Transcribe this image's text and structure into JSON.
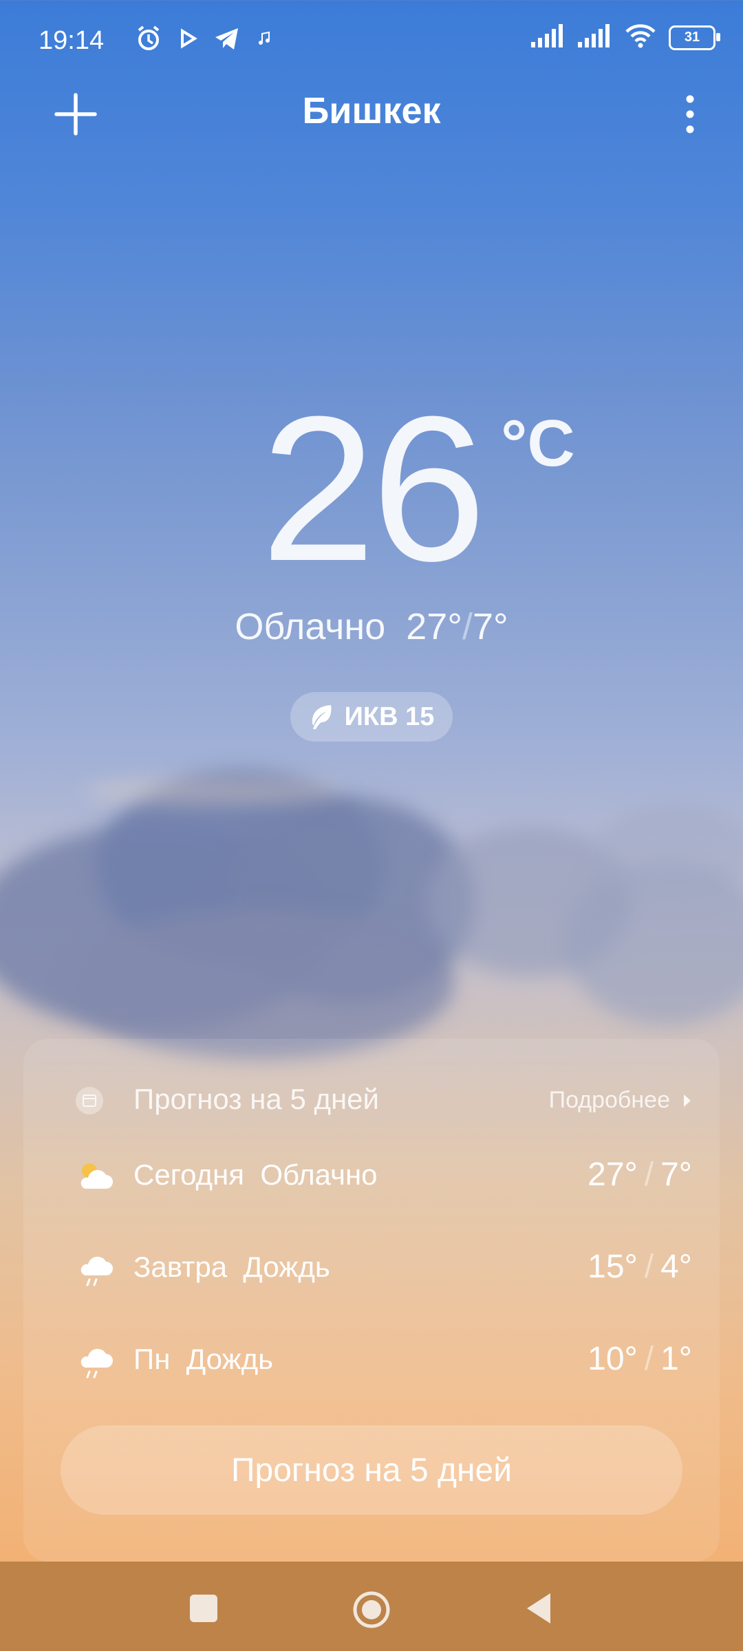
{
  "status_bar": {
    "time": "19:14",
    "battery": "31",
    "left_icons": [
      "alarm-icon",
      "play-icon",
      "telegram-icon",
      "music-icon"
    ],
    "right_icons": [
      "signal-icon",
      "signal-icon",
      "wifi-icon",
      "battery-icon"
    ]
  },
  "header": {
    "city": "Бишкек",
    "add_icon": "plus-icon",
    "menu_icon": "more-vert-icon"
  },
  "current": {
    "temperature": "26",
    "unit": "°C",
    "condition": "Облачно",
    "high": "27°",
    "low": "7°"
  },
  "aqi": {
    "label": "ИКВ 15",
    "icon": "leaf-icon"
  },
  "forecast_card": {
    "title": "Прогноз на 5 дней",
    "more_label": "Подробнее",
    "rows": [
      {
        "day": "Сегодня",
        "condition": "Облачно",
        "high": "27°",
        "low": "7°",
        "icon": "partly-cloudy-icon"
      },
      {
        "day": "Завтра",
        "condition": "Дождь",
        "high": "15°",
        "low": "4°",
        "icon": "rain-icon"
      },
      {
        "day": "Пн",
        "condition": "Дождь",
        "high": "10°",
        "low": "1°",
        "icon": "rain-icon"
      }
    ],
    "button_label": "Прогноз на 5 дней"
  },
  "colors": {
    "sky_top": "#3c7cd8",
    "sky_bottom": "#f3ad6a",
    "navbar": "#bd8349"
  }
}
